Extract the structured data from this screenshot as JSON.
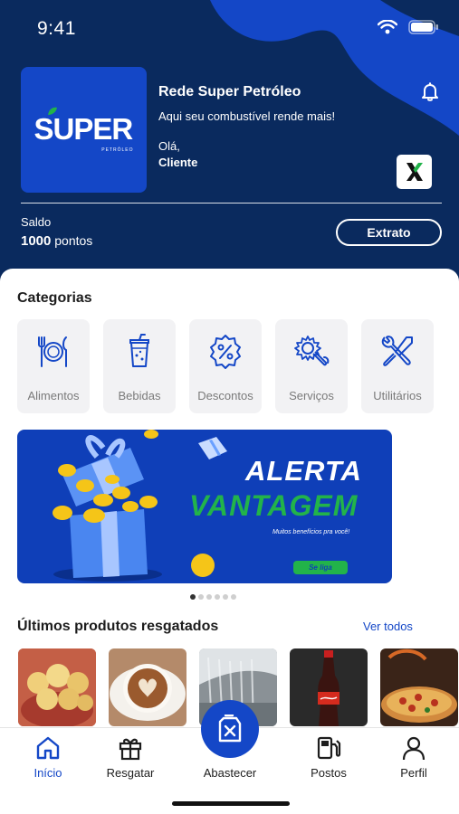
{
  "status": {
    "time": "9:41"
  },
  "header": {
    "logo_text": "SUPER",
    "logo_sub": "PETRÓLEO",
    "title": "Rede Super Petróleo",
    "slogan": "Aqui seu combustível rende mais!",
    "greeting": "Olá,",
    "user_name": "Cliente",
    "balance_label": "Saldo",
    "balance_points": "1000",
    "balance_unit": "pontos",
    "statement_button": "Extrato"
  },
  "categories": {
    "title": "Categorias",
    "items": [
      {
        "label": "Alimentos",
        "icon": "fork-knife-plate-icon"
      },
      {
        "label": "Bebidas",
        "icon": "drink-cup-icon"
      },
      {
        "label": "Descontos",
        "icon": "percent-badge-icon"
      },
      {
        "label": "Serviços",
        "icon": "gear-wrench-icon"
      },
      {
        "label": "Utilitários",
        "icon": "tools-icon"
      }
    ]
  },
  "banner": {
    "line1": "ALERTA",
    "line2": "VANTAGEM",
    "subtitle": "Muitos benefícios pra você!",
    "button": "Se liga",
    "page_count": 6,
    "active_page": 1
  },
  "recent": {
    "title": "Últimos produtos resgatados",
    "see_all": "Ver todos",
    "products": [
      "pao-de-queijo",
      "cappuccino",
      "car-wash",
      "coca-cola",
      "pizza"
    ]
  },
  "nav": {
    "items": [
      {
        "label": "Início",
        "active": true
      },
      {
        "label": "Resgatar"
      },
      {
        "label": "Abastecer"
      },
      {
        "label": "Postos"
      },
      {
        "label": "Perfil"
      }
    ]
  },
  "colors": {
    "primary": "#1447c7",
    "header": "#0a2a5e",
    "accent_green": "#22b34a"
  }
}
